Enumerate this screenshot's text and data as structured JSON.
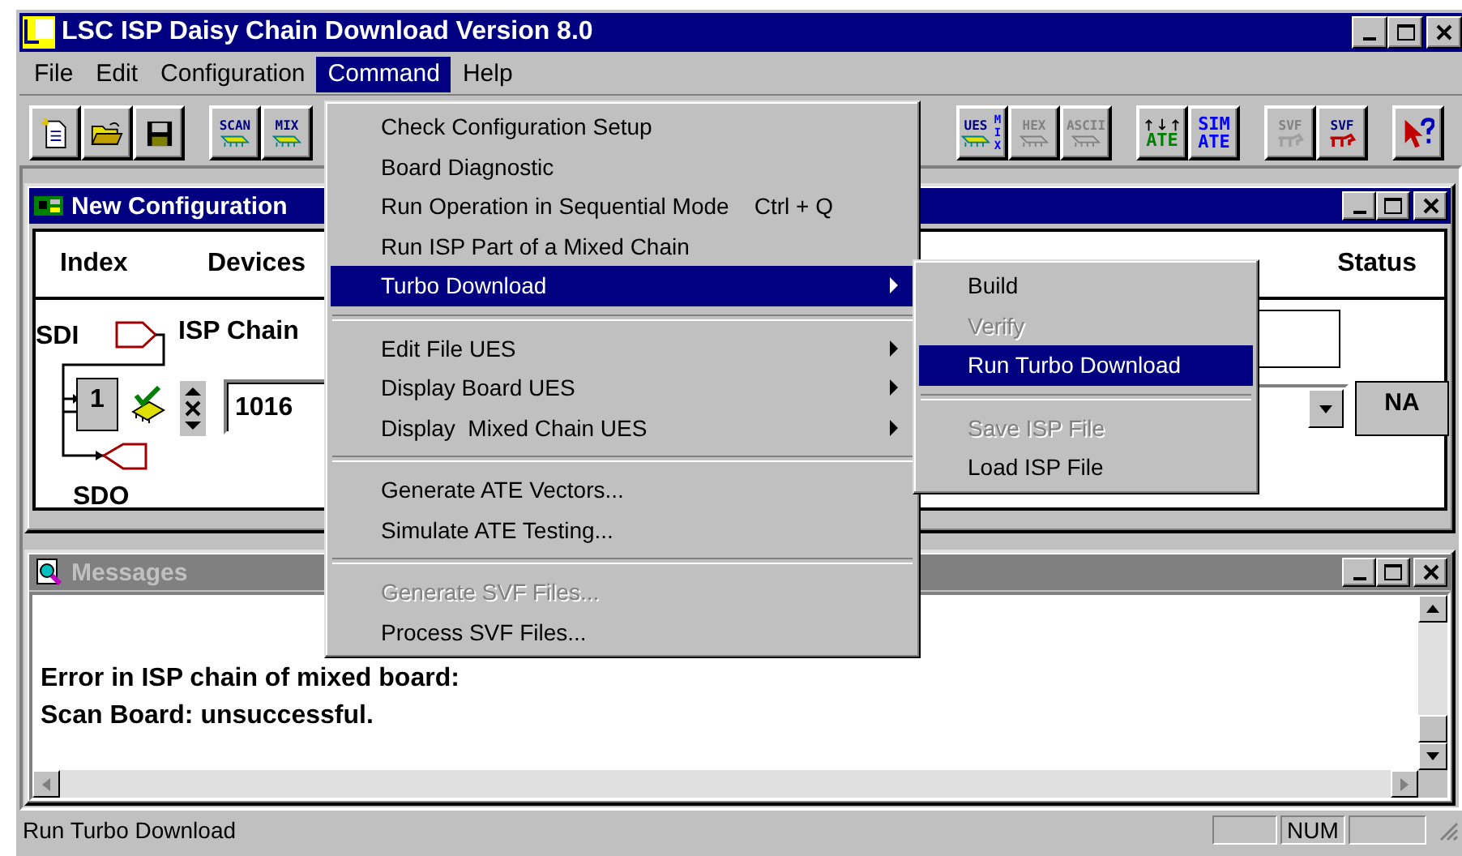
{
  "window": {
    "title": "LSC ISP Daisy Chain Download Version 8.0"
  },
  "menu_bar": [
    {
      "label": "File",
      "selected": false
    },
    {
      "label": "Edit",
      "selected": false
    },
    {
      "label": "Configuration",
      "selected": false
    },
    {
      "label": "Command",
      "selected": true
    },
    {
      "label": "Help",
      "selected": false
    }
  ],
  "toolbar": {
    "groups": [
      {
        "buttons": [
          {
            "kind": "new"
          },
          {
            "kind": "open"
          },
          {
            "kind": "save"
          }
        ]
      },
      {
        "buttons": [
          {
            "kind": "board",
            "label": "SCAN",
            "color": "#000080",
            "disabled": false
          },
          {
            "kind": "board",
            "label": "MIX",
            "color": "#000080",
            "disabled": false
          }
        ]
      },
      {
        "buttons": [
          {
            "kind": "board",
            "label": "UES",
            "side_label": "MIX",
            "color": "#000080",
            "disabled": false
          },
          {
            "kind": "board",
            "label": "HEX",
            "disabled": true
          },
          {
            "kind": "board",
            "label": "ASCII",
            "disabled": true
          }
        ]
      },
      {
        "buttons": [
          {
            "kind": "ate",
            "label": "ATE",
            "color": "#008000",
            "disabled": false
          },
          {
            "kind": "stacked",
            "label": "SIM ATE",
            "color": "#0000ff",
            "disabled": false
          }
        ]
      },
      {
        "buttons": [
          {
            "kind": "svf",
            "label": "SVF",
            "disabled": true
          },
          {
            "kind": "svf",
            "label": "SVF",
            "color": "#000080",
            "disabled": false
          }
        ]
      },
      {
        "buttons": [
          {
            "kind": "help"
          }
        ]
      }
    ]
  },
  "configuration_window": {
    "title": "New Configuration",
    "active": true,
    "columns": [
      "Index",
      "Devices",
      "Status"
    ],
    "chain": {
      "input": "SDI",
      "label": "ISP Chain",
      "output": "SDO",
      "device_index": "1",
      "value": "1016",
      "status": "NA"
    }
  },
  "messages_window": {
    "title": "Messages",
    "active": false,
    "lines": [
      "Error in ISP chain of mixed board:",
      "Scan Board: unsuccessful."
    ]
  },
  "command_menu": {
    "items": [
      {
        "kind": "item",
        "label": "Check Configuration Setup",
        "disabled": false,
        "selected": false
      },
      {
        "kind": "item",
        "label": "Board Diagnostic",
        "disabled": false,
        "selected": false
      },
      {
        "kind": "item",
        "label": "Run Operation in Sequential Mode",
        "shortcut": "Ctrl + Q",
        "disabled": false,
        "selected": false
      },
      {
        "kind": "item",
        "label": "Run ISP Part of a Mixed Chain",
        "disabled": false,
        "selected": false
      },
      {
        "kind": "submenu",
        "label": "Turbo Download",
        "disabled": false,
        "selected": true
      },
      {
        "kind": "separator"
      },
      {
        "kind": "submenu",
        "label": "Edit File UES",
        "disabled": false,
        "selected": false
      },
      {
        "kind": "submenu",
        "label": "Display Board UES",
        "disabled": false,
        "selected": false
      },
      {
        "kind": "submenu",
        "label": "Display  Mixed Chain UES",
        "disabled": false,
        "selected": false
      },
      {
        "kind": "separator"
      },
      {
        "kind": "item",
        "label": "Generate ATE Vectors...",
        "disabled": false,
        "selected": false
      },
      {
        "kind": "item",
        "label": "Simulate ATE Testing...",
        "disabled": false,
        "selected": false
      },
      {
        "kind": "separator"
      },
      {
        "kind": "item",
        "label": "Generate SVF Files...",
        "disabled": true,
        "selected": false
      },
      {
        "kind": "item",
        "label": "Process SVF Files...",
        "disabled": false,
        "selected": false
      }
    ]
  },
  "turbo_download_menu": {
    "items": [
      {
        "kind": "item",
        "label": "Build",
        "disabled": false,
        "selected": false
      },
      {
        "kind": "item",
        "label": "Verify",
        "disabled": true,
        "selected": false
      },
      {
        "kind": "item",
        "label": "Run Turbo Download",
        "disabled": false,
        "selected": true
      },
      {
        "kind": "separator"
      },
      {
        "kind": "item",
        "label": "Save ISP File",
        "disabled": true,
        "selected": false
      },
      {
        "kind": "item",
        "label": "Load ISP File",
        "disabled": false,
        "selected": false
      }
    ]
  },
  "status_bar": {
    "text": "Run Turbo Download",
    "indicators": [
      "NUM"
    ]
  }
}
